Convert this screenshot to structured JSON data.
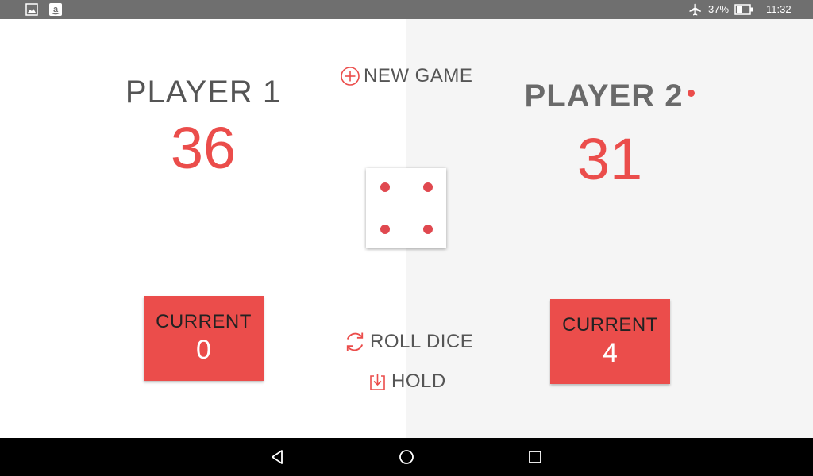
{
  "status_bar": {
    "icons_left": [
      "image-icon",
      "amazon-icon"
    ],
    "battery": "37%",
    "time": "11:32"
  },
  "game": {
    "new_game_label": "NEW GAME",
    "roll_dice_label": "ROLL DICE",
    "hold_label": "HOLD",
    "dice_value": 4,
    "players": [
      {
        "name": "PLAYER 1",
        "score": "36",
        "current_label": "CURRENT",
        "current_value": "0",
        "active": false
      },
      {
        "name": "PLAYER 2",
        "score": "31",
        "current_label": "CURRENT",
        "current_value": "4",
        "active": true
      }
    ]
  },
  "colors": {
    "accent": "#eb4d4b",
    "status_bar": "#6f6f6f",
    "right_panel": "#f5f5f5",
    "nav_bar": "#000000"
  },
  "nav_bar": {
    "buttons": [
      "back-icon",
      "home-icon",
      "recents-icon"
    ]
  }
}
